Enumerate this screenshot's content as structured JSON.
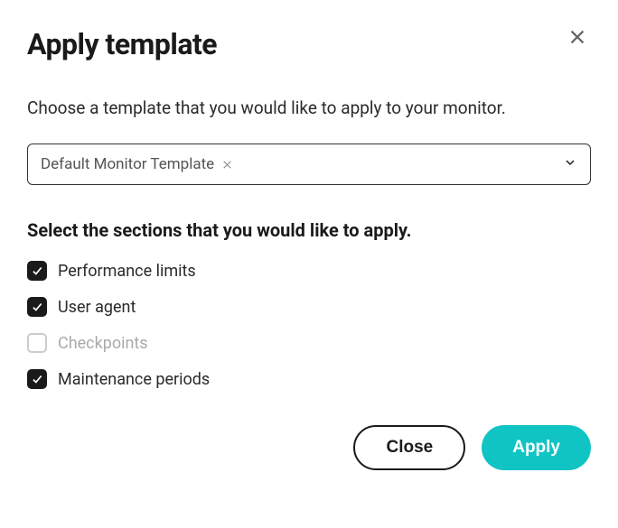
{
  "dialog": {
    "title": "Apply template",
    "description": "Choose a template that you would like to apply to your monitor."
  },
  "template_select": {
    "selected": "Default Monitor Template"
  },
  "sections": {
    "heading": "Select the sections that you would like to apply.",
    "items": [
      {
        "label": "Performance limits",
        "checked": true,
        "disabled": false
      },
      {
        "label": "User agent",
        "checked": true,
        "disabled": false
      },
      {
        "label": "Checkpoints",
        "checked": false,
        "disabled": true
      },
      {
        "label": "Maintenance periods",
        "checked": true,
        "disabled": false
      }
    ]
  },
  "buttons": {
    "close": "Close",
    "apply": "Apply"
  }
}
